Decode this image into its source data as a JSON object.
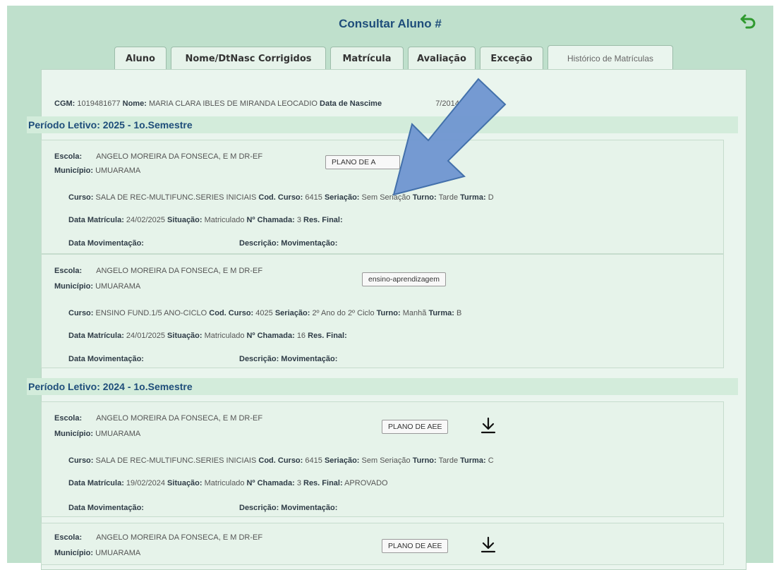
{
  "header": {
    "title": "Consultar Aluno #"
  },
  "tabs": [
    {
      "label": "Aluno"
    },
    {
      "label": "Nome/DtNasc Corrigidos"
    },
    {
      "label": "Matrícula"
    },
    {
      "label": "Avaliação"
    },
    {
      "label": "Exceção"
    },
    {
      "label": "Histórico de Matrículas",
      "active": true
    }
  ],
  "student": {
    "cgm_label": "CGM:",
    "cgm": "1019481677",
    "nome_label": "Nome:",
    "nome": "MARIA CLARA IBLES DE MIRANDA LEOCADIO",
    "nasc_label": "Data de Nascime",
    "nasc_tail": "7/2014"
  },
  "labels": {
    "escola": "Escola:",
    "municipio": "Município:",
    "curso": "Curso:",
    "cod_curso": "Cod. Curso:",
    "seriacao": "Seriação:",
    "turno": "Turno:",
    "turma": "Turma:",
    "data_matricula": "Data Matrícula:",
    "situacao": "Situação:",
    "chamada": "Nº Chamada:",
    "res_final": "Res. Final:",
    "data_mov": "Data Movimentação:",
    "desc_mov": "Descrição: Movimentação:"
  },
  "periods": [
    {
      "title": "Período Letivo: 2025 - 1o.Semestre",
      "records": [
        {
          "escola": "ANGELO MOREIRA DA FONSECA, E M DR-EF",
          "municipio": "UMUARAMA",
          "button": "PLANO DE A",
          "curso": "SALA DE REC-MULTIFUNC.SERIES INICIAIS",
          "cod_curso": "6415",
          "seriacao": "Sem Seriação",
          "turno": "Tarde",
          "turma": "D",
          "data_matricula": "24/02/2025",
          "situacao": "Matriculado",
          "chamada": "3",
          "res_final": ""
        },
        {
          "escola": "ANGELO MOREIRA DA FONSECA, E M DR-EF",
          "municipio": "UMUARAMA",
          "button": "ensino-aprendizagem",
          "curso": "ENSINO FUND.1/5 ANO-CICLO",
          "cod_curso": "4025",
          "seriacao": "2º Ano do 2º Ciclo",
          "turno": "Manhã",
          "turma": "B",
          "data_matricula": "24/01/2025",
          "situacao": "Matriculado",
          "chamada": "16",
          "res_final": ""
        }
      ]
    },
    {
      "title": "Período Letivo: 2024 - 1o.Semestre",
      "records": [
        {
          "escola": "ANGELO MOREIRA DA FONSECA, E M DR-EF",
          "municipio": "UMUARAMA",
          "button": "PLANO DE AEE",
          "curso": "SALA DE REC-MULTIFUNC.SERIES INICIAIS",
          "cod_curso": "6415",
          "seriacao": "Sem Seriação",
          "turno": "Tarde",
          "turma": "C",
          "data_matricula": "19/02/2024",
          "situacao": "Matriculado",
          "chamada": "3",
          "res_final": "APROVADO"
        },
        {
          "escola": "ANGELO MOREIRA DA FONSECA, E M DR-EF",
          "municipio": "UMUARAMA",
          "button": "PLANO DE AEE"
        }
      ]
    }
  ],
  "colors": {
    "background": "#bfe0cc",
    "panel": "#eaf5ee",
    "title": "#1e4d7a",
    "annotation_arrow": "#5b8ac7"
  },
  "icons": [
    "back-arrow-icon",
    "download-icon",
    "annotation-arrow"
  ]
}
